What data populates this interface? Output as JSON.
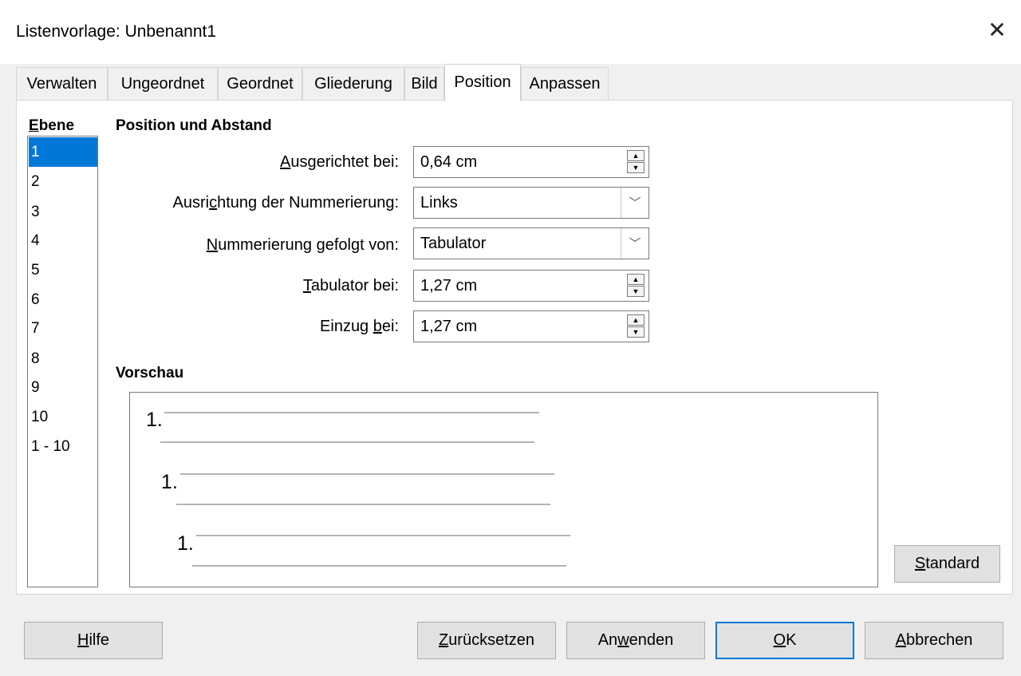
{
  "window": {
    "title": "Listenvorlage: Unbenannt1",
    "close_glyph": "✕"
  },
  "tabs": [
    {
      "label": "Verwalten"
    },
    {
      "label": "Ungeordnet"
    },
    {
      "label": "Geordnet"
    },
    {
      "label": "Gliederung"
    },
    {
      "label": "Bild"
    },
    {
      "label": "Position",
      "active": true
    },
    {
      "label": "Anpassen"
    }
  ],
  "levels": {
    "label_first": "E",
    "label_rest": "bene",
    "items": [
      "1",
      "2",
      "3",
      "4",
      "5",
      "6",
      "7",
      "8",
      "9",
      "10",
      "1 - 10"
    ],
    "selected": "1"
  },
  "position": {
    "section_title": "Position und Abstand",
    "aligned_at": {
      "label_u": "A",
      "label_rest": "usgerichtet bei:",
      "value": "0,64 cm"
    },
    "numbering_alignment": {
      "label_pre": "Ausri",
      "label_u": "c",
      "label_rest": "htung der Nummerierung:",
      "value": "Links"
    },
    "followed_by": {
      "label_u": "N",
      "label_rest": "ummerierung gefolgt von:",
      "value": "Tabulator"
    },
    "tab_stop_at": {
      "label_u": "T",
      "label_rest": "abulator bei:",
      "value": "1,27 cm"
    },
    "indent_at": {
      "label_pre": "Einzug ",
      "label_u": "b",
      "label_rest": "ei:",
      "value": "1,27 cm"
    }
  },
  "preview": {
    "title": "Vorschau",
    "numbers": [
      "1.",
      "1.",
      "1."
    ]
  },
  "buttons": {
    "standard": {
      "u": "S",
      "rest": "tandard"
    },
    "help": {
      "u": "H",
      "rest": "ilfe"
    },
    "reset": {
      "u": "Z",
      "rest": "urücksetzen"
    },
    "apply": {
      "pre": "An",
      "u": "w",
      "rest": "enden"
    },
    "ok": {
      "u": "O",
      "rest": "K"
    },
    "cancel": {
      "u": "A",
      "rest": "bbrechen"
    }
  },
  "colors": {
    "accent": "#0078d7",
    "selection_text": "#ffffff",
    "preview_line": "#b4b4b4"
  },
  "icons": {
    "close": "close-icon",
    "spin_up": "spin-up-icon",
    "spin_down": "spin-down-icon",
    "dropdown": "chevron-down-icon"
  }
}
